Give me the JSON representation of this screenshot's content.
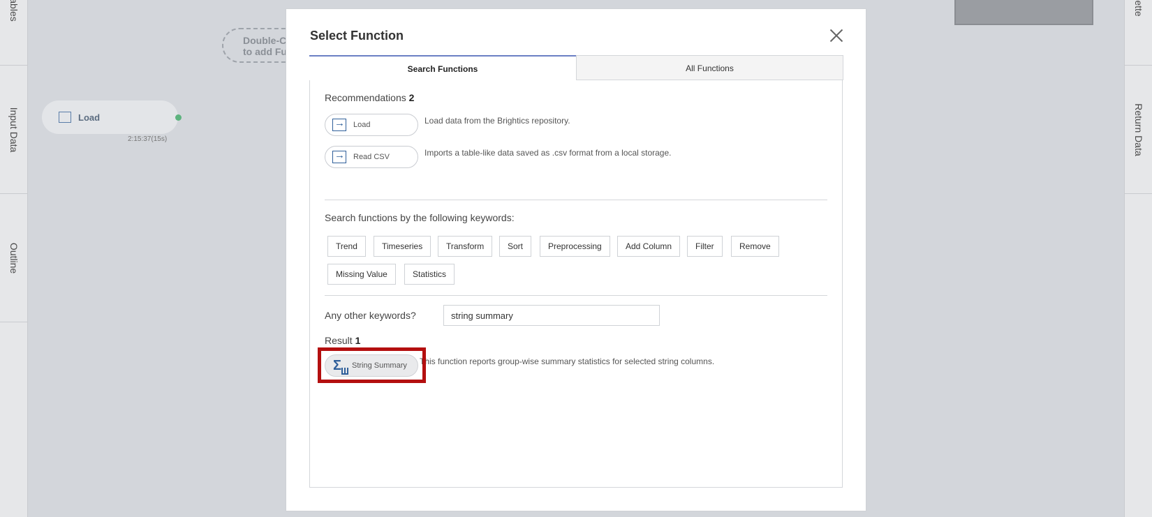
{
  "background": {
    "left_rail": [
      "ables",
      "Input Data",
      "Outline"
    ],
    "right_rail": [
      "ette",
      "Return Data"
    ],
    "hint_text_line1": "Double-C",
    "hint_text_line2": "to add Fu",
    "node_label": "Load",
    "node_time": "2:15:37(15s)"
  },
  "modal": {
    "title": "Select Function",
    "tabs": [
      {
        "label": "Search Functions",
        "active": true
      },
      {
        "label": "All Functions",
        "active": false
      }
    ],
    "recommendations": {
      "label": "Recommendations",
      "count": "2",
      "items": [
        {
          "name": "Load",
          "description": "Load data from the Brightics repository."
        },
        {
          "name": "Read CSV",
          "description": "Imports a table-like data saved as .csv format from a local storage."
        }
      ]
    },
    "keywords_label": "Search functions by the following keywords:",
    "keywords": [
      "Trend",
      "Timeseries",
      "Transform",
      "Sort",
      "Preprocessing",
      "Add Column",
      "Filter",
      "Remove",
      "Missing Value",
      "Statistics"
    ],
    "other_keywords_label": "Any other keywords?",
    "other_keywords_value": "string summary",
    "result": {
      "label": "Result",
      "count": "1",
      "items": [
        {
          "name": "String Summary",
          "description": "This function reports group-wise summary statistics for selected string columns."
        }
      ]
    }
  },
  "colors": {
    "accent": "#6b7fc4",
    "icon": "#2f5f9a",
    "highlight": "#b40f0f"
  }
}
